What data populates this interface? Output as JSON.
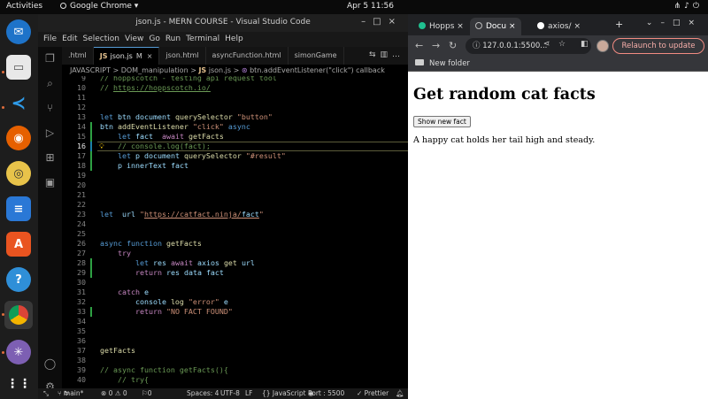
{
  "topbar": {
    "activities": "Activities",
    "app_name": "Google Chrome",
    "clock": "Apr 5  11:56"
  },
  "vscode": {
    "title": "json.js - MERN COURSE - Visual Studio Code",
    "menu": [
      "File",
      "Edit",
      "Selection",
      "View",
      "Go",
      "Run",
      "Terminal",
      "Help"
    ],
    "tabs": [
      {
        "label": ".html",
        "active": false
      },
      {
        "label": "json.js",
        "active": true,
        "modified": "M"
      },
      {
        "label": "json.html",
        "active": false
      },
      {
        "label": "asyncFunction.html",
        "active": false
      },
      {
        "label": "simonGame",
        "active": false
      }
    ],
    "breadcrumb": {
      "parts": [
        "JAVASCRIPT",
        "DOM_manipulation",
        "json.js",
        "btn.addEventListener(\"click\") callback"
      ]
    },
    "lines": [
      {
        "n": "9",
        "text": "// hoppscotch - testing api request tool"
      },
      {
        "n": "10",
        "text": "// https://hoppscotch.io/"
      },
      {
        "n": "11",
        "text": ""
      },
      {
        "n": "12",
        "text": ""
      },
      {
        "n": "13",
        "text": "let btn=document.querySelector(\"button\");"
      },
      {
        "n": "14",
        "text": "btn.addEventListener(\"click\",async ()=>{"
      },
      {
        "n": "15",
        "text": "    let fact= await getFacts();"
      },
      {
        "n": "16",
        "text": "    // console.log(fact);"
      },
      {
        "n": "17",
        "text": "    let p=document.querySelector(\"#result\");"
      },
      {
        "n": "18",
        "text": "    p.innerText=fact;"
      },
      {
        "n": "19",
        "text": "});"
      },
      {
        "n": "20",
        "text": ""
      },
      {
        "n": "21",
        "text": ""
      },
      {
        "n": "22",
        "text": ""
      },
      {
        "n": "23",
        "text": "let  url=\"https://catfact.ninja/fact\";"
      },
      {
        "n": "24",
        "text": ""
      },
      {
        "n": "25",
        "text": ""
      },
      {
        "n": "26",
        "text": "async function getFacts(){"
      },
      {
        "n": "27",
        "text": "    try{"
      },
      {
        "n": "28",
        "text": "        let res=await axios.get(url);"
      },
      {
        "n": "29",
        "text": "        return res.data.fact;"
      },
      {
        "n": "30",
        "text": "    }"
      },
      {
        "n": "31",
        "text": "    catch(e){"
      },
      {
        "n": "32",
        "text": "        console.log(\"error\",e);"
      },
      {
        "n": "33",
        "text": "        return \"NO FACT FOUND\";"
      },
      {
        "n": "34",
        "text": "    }"
      },
      {
        "n": "35",
        "text": "}"
      },
      {
        "n": "36",
        "text": ""
      },
      {
        "n": "37",
        "text": "getFacts();"
      },
      {
        "n": "38",
        "text": ""
      },
      {
        "n": "39",
        "text": "// async function getFacts(){"
      },
      {
        "n": "40",
        "text": "    // try{"
      }
    ],
    "status": {
      "branch": "main*",
      "problems": "⊗ 0 ⚠ 0",
      "ports": "⚐0",
      "spaces": "Spaces: 4",
      "encoding": "UTF-8",
      "eol": "LF",
      "language": "{} JavaScript",
      "port": "Port : 5500",
      "prettier": "✓ Prettier"
    }
  },
  "chrome": {
    "tabs": [
      {
        "label": "Hopps",
        "fav_color": "#1fbf8f"
      },
      {
        "label": "Docu",
        "fav_color": "#9aa0a6"
      },
      {
        "label": "axios/",
        "fav_color": "#ffffff"
      }
    ],
    "url": "127.0.0.1:5500...",
    "relaunch": "Relaunch to update",
    "bookmark": "New folder",
    "page": {
      "heading": "Get random cat facts",
      "button": "Show new fact",
      "result": "A happy cat holds her tail high and steady."
    }
  }
}
